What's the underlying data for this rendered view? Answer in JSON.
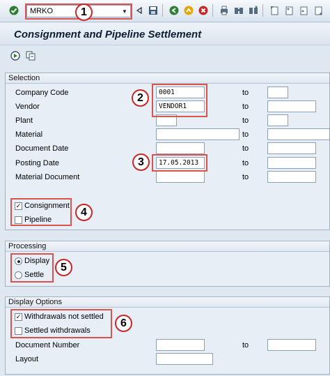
{
  "toolbar": {
    "command_field": "MRKO",
    "icons": [
      "enter-icon",
      "back-triangle-icon",
      "save-icon",
      "back-icon",
      "exit-icon",
      "cancel-icon",
      "print-icon",
      "find-icon",
      "find-next-icon",
      "first-page-icon",
      "previous-page-icon",
      "next-page-icon",
      "last-page-icon"
    ]
  },
  "title": "Consignment and Pipeline Settlement",
  "app_toolbar": {
    "icons": [
      "execute-icon",
      "get-variant-icon"
    ]
  },
  "selection": {
    "header": "Selection",
    "rows": [
      {
        "label": "Company Code",
        "from": "0001",
        "to_label": "to",
        "to": ""
      },
      {
        "label": "Vendor",
        "from": "VENDOR1",
        "to_label": "to",
        "to": ""
      },
      {
        "label": "Plant",
        "from": "",
        "to_label": "to",
        "to": ""
      },
      {
        "label": "Material",
        "from": "",
        "to_label": "to",
        "to": ""
      },
      {
        "label": "Document Date",
        "from": "",
        "to_label": "to",
        "to": ""
      },
      {
        "label": "Posting Date",
        "from": "17.05.2013",
        "to_label": "to",
        "to": ""
      },
      {
        "label": "Material Document",
        "from": "",
        "to_label": "to",
        "to": ""
      }
    ],
    "checkboxes": [
      {
        "label": "Consignment",
        "checked": true
      },
      {
        "label": "Pipeline",
        "checked": false
      }
    ]
  },
  "processing": {
    "header": "Processing",
    "options": [
      {
        "label": "Display",
        "selected": true
      },
      {
        "label": "Settle",
        "selected": false
      }
    ]
  },
  "display_options": {
    "header": "Display Options",
    "checkboxes": [
      {
        "label": "Withdrawals not settled",
        "checked": true
      },
      {
        "label": "Settled withdrawals",
        "checked": false
      }
    ],
    "document_number": {
      "label": "Document Number",
      "from": "",
      "to_label": "to",
      "to": ""
    },
    "layout": {
      "label": "Layout",
      "value": ""
    }
  },
  "annotations": [
    "1",
    "2",
    "3",
    "4",
    "5",
    "6"
  ],
  "colors": {
    "annotation_red": "#d9534f",
    "background": "#dfe8f1"
  }
}
